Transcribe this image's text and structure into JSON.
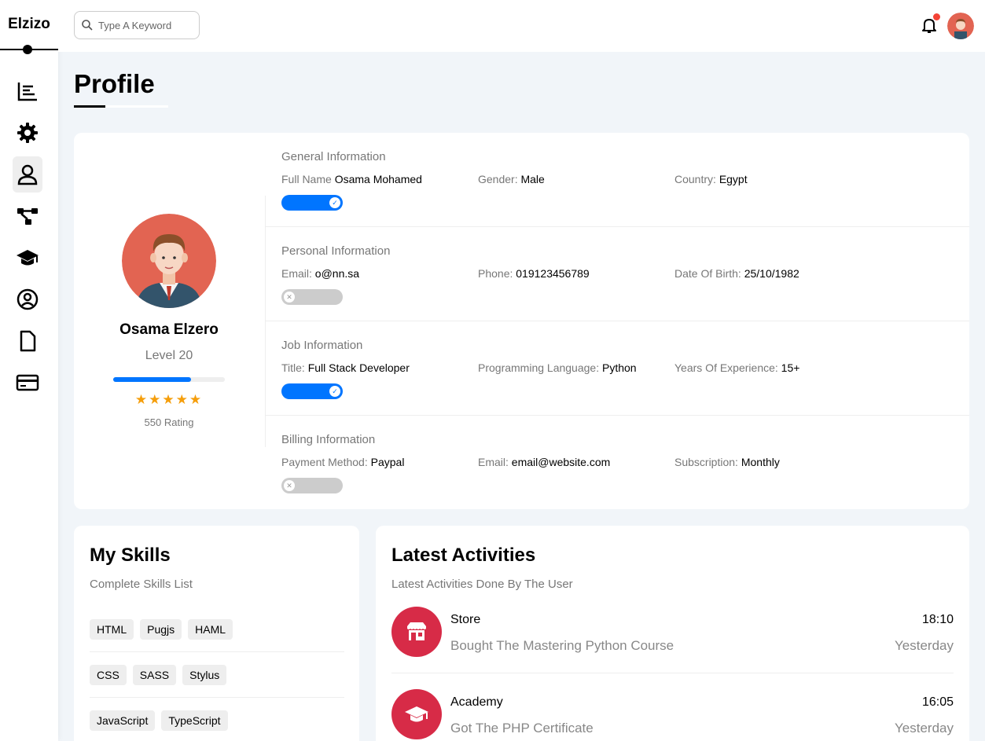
{
  "sidebar": {
    "logo": "Elzizo",
    "items": [
      {
        "icon": "dashboard-icon"
      },
      {
        "icon": "settings-icon"
      },
      {
        "icon": "profile-icon",
        "active": true
      },
      {
        "icon": "projects-icon"
      },
      {
        "icon": "courses-icon"
      },
      {
        "icon": "friends-icon"
      },
      {
        "icon": "files-icon"
      },
      {
        "icon": "plans-icon"
      }
    ]
  },
  "header": {
    "search_placeholder": "Type A Keyword"
  },
  "page": {
    "title": "Profile"
  },
  "profile": {
    "name": "Osama Elzero",
    "level": "Level 20",
    "level_progress": 0.7,
    "stars": "★★★★★",
    "rating": "550 Rating"
  },
  "sections": [
    {
      "title": "General Information",
      "fields": [
        {
          "label": "Full Name ",
          "value": "Osama Mohamed"
        },
        {
          "label": "Gender: ",
          "value": "Male"
        },
        {
          "label": "Country: ",
          "value": "Egypt"
        }
      ],
      "toggle_on": true
    },
    {
      "title": "Personal Information",
      "fields": [
        {
          "label": "Email: ",
          "value": "o@nn.sa"
        },
        {
          "label": "Phone: ",
          "value": "019123456789"
        },
        {
          "label": "Date Of Birth: ",
          "value": "25/10/1982"
        }
      ],
      "toggle_on": false
    },
    {
      "title": "Job Information",
      "fields": [
        {
          "label": "Title: ",
          "value": "Full Stack Developer"
        },
        {
          "label": "Programming Language: ",
          "value": "Python"
        },
        {
          "label": "Years Of Experience: ",
          "value": "15+"
        }
      ],
      "toggle_on": true
    },
    {
      "title": "Billing Information",
      "fields": [
        {
          "label": "Payment Method: ",
          "value": "Paypal"
        },
        {
          "label": "Email: ",
          "value": "email@website.com"
        },
        {
          "label": "Subscription: ",
          "value": "Monthly"
        }
      ],
      "toggle_on": false
    }
  ],
  "skills": {
    "title": "My Skills",
    "subtitle": "Complete Skills List",
    "rows": [
      [
        "HTML",
        "Pugjs",
        "HAML"
      ],
      [
        "CSS",
        "SASS",
        "Stylus"
      ],
      [
        "JavaScript",
        "TypeScript"
      ]
    ]
  },
  "activities": {
    "title": "Latest Activities",
    "subtitle": "Latest Activities Done By The User",
    "items": [
      {
        "name": "Store",
        "desc": "Bought The Mastering Python Course",
        "time": "18:10",
        "day": "Yesterday",
        "icon": "store-icon"
      },
      {
        "name": "Academy",
        "desc": "Got The PHP Certificate",
        "time": "16:05",
        "day": "Yesterday",
        "icon": "graduation-cap-icon"
      }
    ]
  }
}
